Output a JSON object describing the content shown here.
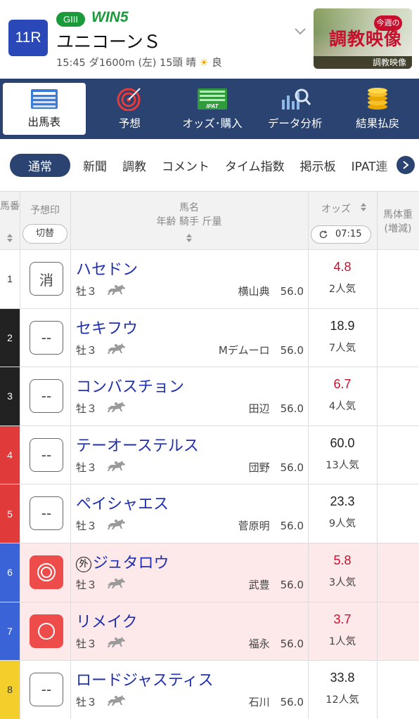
{
  "header": {
    "race_number": "11R",
    "grade": "GIII",
    "win5": "WIN5",
    "race_name": "ユニコーンＳ",
    "info_time": "15:45",
    "info_course": "ダ1600m (左) 15頭 晴",
    "info_weather_icon": "sun-icon",
    "info_going": "良",
    "video_badge": "今週の",
    "video_big": "調教映像",
    "video_label": "調教映像"
  },
  "nav": {
    "items": [
      {
        "label": "出馬表",
        "icon": "list-icon",
        "active": true
      },
      {
        "label": "予想",
        "icon": "target-icon",
        "active": false
      },
      {
        "label": "オッズ･購入",
        "icon": "ipat-icon",
        "active": false
      },
      {
        "label": "データ分析",
        "icon": "chart-search-icon",
        "active": false
      },
      {
        "label": "結果払戻",
        "icon": "coins-icon",
        "active": false
      }
    ]
  },
  "tabs": [
    "通常",
    "新聞",
    "調教",
    "コメント",
    "タイム指数",
    "掲示板",
    "IPAT連"
  ],
  "table_header": {
    "col_number": "馬番",
    "col_mark": "予想印",
    "btn_kirikae": "切替",
    "col_name_1": "馬名",
    "col_name_2": "年齢 騎手 斤量",
    "col_odds": "オッズ",
    "odds_time": "07:15",
    "col_weight_1": "馬体重",
    "col_weight_2": "(増減)"
  },
  "colors": {
    "frame_1": "#ffffff",
    "frame_2": "#222222",
    "frame_3": "#222222",
    "frame_4": "#e03a3a",
    "frame_5": "#e03a3a",
    "frame_6": "#3a63d8",
    "frame_7": "#3a63d8",
    "frame_8": "#f2cf2a",
    "navy": "#2a4370",
    "odds_red": "#c8102e",
    "horse_blue": "#1f2fb0"
  },
  "rows": [
    {
      "no": "1",
      "mark": "消",
      "name": "ハセドン",
      "gaiko": "",
      "sexage": "牡３",
      "jockey": "横山典",
      "weight": "56.0",
      "odds": "4.8",
      "pop": "2人気",
      "odds_red": true,
      "highlight": false,
      "mark_style": "text"
    },
    {
      "no": "2",
      "mark": "--",
      "name": "セキフウ",
      "gaiko": "",
      "sexage": "牡３",
      "jockey": "Mデムーロ",
      "weight": "56.0",
      "odds": "18.9",
      "pop": "7人気",
      "odds_red": false,
      "highlight": false,
      "mark_style": "text"
    },
    {
      "no": "3",
      "mark": "--",
      "name": "コンバスチョン",
      "gaiko": "",
      "sexage": "牡３",
      "jockey": "田辺",
      "weight": "56.0",
      "odds": "6.7",
      "pop": "4人気",
      "odds_red": true,
      "highlight": false,
      "mark_style": "text"
    },
    {
      "no": "4",
      "mark": "--",
      "name": "テーオーステルス",
      "gaiko": "",
      "sexage": "牡３",
      "jockey": "団野",
      "weight": "56.0",
      "odds": "60.0",
      "pop": "13人気",
      "odds_red": false,
      "highlight": false,
      "mark_style": "text"
    },
    {
      "no": "5",
      "mark": "--",
      "name": "ペイシャエス",
      "gaiko": "",
      "sexage": "牡３",
      "jockey": "菅原明",
      "weight": "56.0",
      "odds": "23.3",
      "pop": "9人気",
      "odds_red": false,
      "highlight": false,
      "mark_style": "text"
    },
    {
      "no": "6",
      "mark": "",
      "name": "ジュタロウ",
      "gaiko": "外",
      "sexage": "牡３",
      "jockey": "武豊",
      "weight": "56.0",
      "odds": "5.8",
      "pop": "3人気",
      "odds_red": true,
      "highlight": true,
      "mark_style": "double-circle"
    },
    {
      "no": "7",
      "mark": "",
      "name": "リメイク",
      "gaiko": "",
      "sexage": "牡３",
      "jockey": "福永",
      "weight": "56.0",
      "odds": "3.7",
      "pop": "1人気",
      "odds_red": true,
      "highlight": true,
      "mark_style": "circle"
    },
    {
      "no": "8",
      "mark": "--",
      "name": "ロードジャスティス",
      "gaiko": "",
      "sexage": "牡３",
      "jockey": "石川",
      "weight": "56.0",
      "odds": "33.8",
      "pop": "12人気",
      "odds_red": false,
      "highlight": false,
      "mark_style": "text"
    }
  ]
}
